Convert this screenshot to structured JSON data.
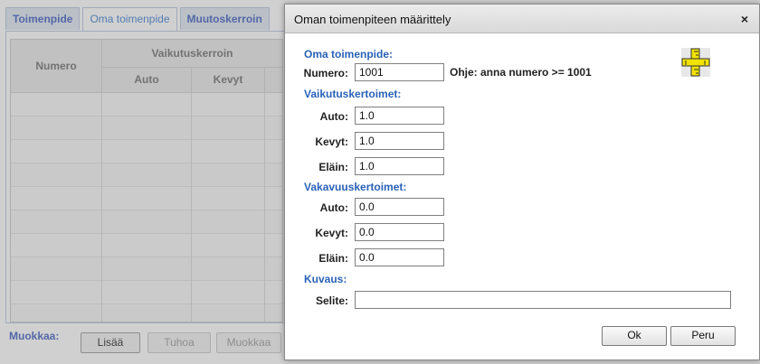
{
  "tabs": [
    "Toimenpide",
    "Oma toimenpide",
    "Muutoskerroin"
  ],
  "grid": {
    "col_numero": "Numero",
    "col_group": "Vaikutuskerroin",
    "sub_auto": "Auto",
    "sub_kevyt": "Kevyt"
  },
  "bottom": {
    "label": "Muokkaa:",
    "add": "Lisää",
    "delete": "Tuhoa",
    "edit": "Muokkaa"
  },
  "dialog": {
    "title": "Oman toimenpiteen määrittely",
    "close_glyph": "×",
    "sec_oma": "Oma toimenpide:",
    "numero_label": "Numero:",
    "numero_value": "1001",
    "hint": "Ohje: anna numero >= 1001",
    "sec_vaikutus": "Vaikutuskertoimet:",
    "vaikutus": {
      "auto_label": "Auto:",
      "auto_value": "1.0",
      "kevyt_label": "Kevyt:",
      "kevyt_value": "1.0",
      "elain_label": "Eläin:",
      "elain_value": "1.0"
    },
    "sec_vakavuus": "Vakavuuskertoimet:",
    "vakavuus": {
      "auto_label": "Auto:",
      "auto_value": "0.0",
      "kevyt_label": "Kevyt:",
      "kevyt_value": "0.0",
      "elain_label": "Eläin:",
      "elain_value": "0.0"
    },
    "sec_kuvaus": "Kuvaus:",
    "selite_label": "Selite:",
    "selite_value": "",
    "ok": "Ok",
    "cancel": "Peru"
  },
  "icons": {
    "ruler": "ruler-icon",
    "close": "close-icon"
  }
}
